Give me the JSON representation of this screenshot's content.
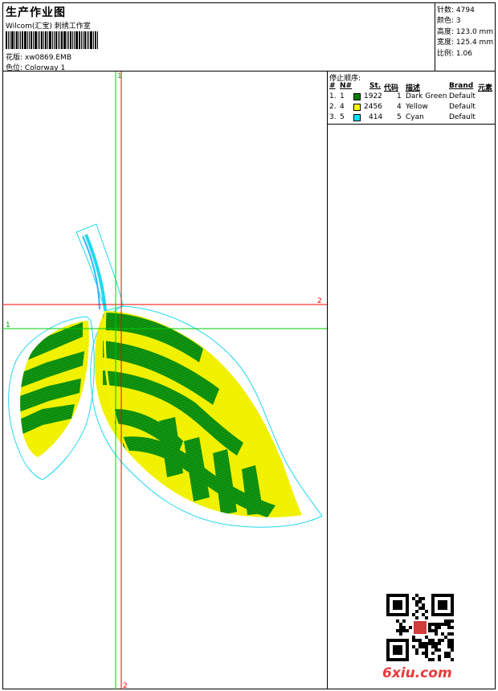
{
  "header": {
    "title": "生产作业图",
    "company": "Wilcom(汇宝) 刺绣工作室",
    "design_label": "花版:",
    "design_value": "xw0869.EMB",
    "colorway_label": "色位:",
    "colorway_value": "Colorway 1"
  },
  "stats": [
    {
      "label": "针数:",
      "value": "4794"
    },
    {
      "label": "颜色:",
      "value": "3"
    },
    {
      "label": "高度:",
      "value": "123.0 mm"
    },
    {
      "label": "宽度:",
      "value": "125.4 mm"
    },
    {
      "label": "比例:",
      "value": "1.06"
    }
  ],
  "stop_sequence": {
    "title": "停止顺序:",
    "headers": {
      "num": "#",
      "needle": "N#",
      "stitches": "St.",
      "code": "代码",
      "desc": "描述",
      "brand": "Brand",
      "element": "元素"
    },
    "rows": [
      {
        "num": "1.",
        "needle": "1",
        "stitches": "1922",
        "code": "1",
        "desc": "Dark Green",
        "brand": "Default",
        "color": "#008000"
      },
      {
        "num": "2.",
        "needle": "4",
        "stitches": "2456",
        "code": "4",
        "desc": "Yellow",
        "brand": "Default",
        "color": "#ffff00"
      },
      {
        "num": "3.",
        "needle": "5",
        "stitches": "414",
        "code": "5",
        "desc": "Cyan",
        "brand": "Default",
        "color": "#00e5ff"
      }
    ]
  },
  "guides": {
    "h1_label": "1",
    "h2_label": "2",
    "v1_label": "1",
    "v2_label": "2",
    "green": "#00cc00",
    "red": "#ff0000"
  },
  "colors": {
    "leaf_green": "#0a8a0a",
    "leaf_yellow": "#f5f500",
    "outline_cyan": "#22d8ee"
  },
  "watermark": "6xiu.com",
  "icons": {
    "qr": "qr-code-icon"
  }
}
